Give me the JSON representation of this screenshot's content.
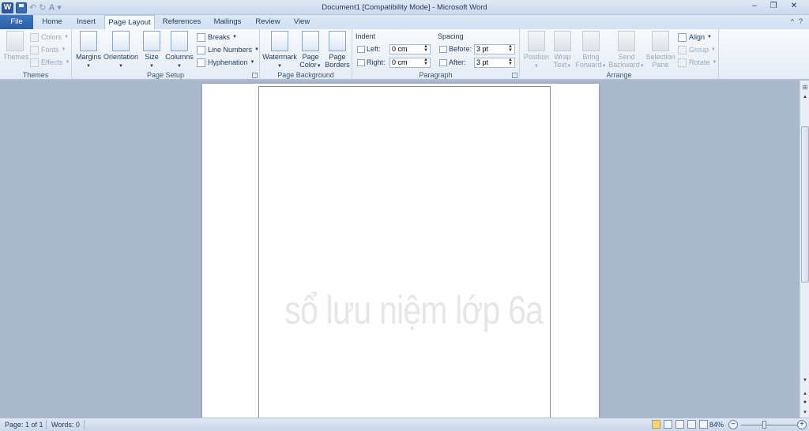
{
  "window": {
    "title": "Document1 [Compatibility Mode] - Microsoft Word",
    "app_letter": "W",
    "qat": {
      "undo": "↶",
      "redo": "↻",
      "font_color": "A",
      "customize": "▾"
    },
    "controls": {
      "minimize": "–",
      "restore": "❐",
      "close": "✕"
    }
  },
  "tabs": {
    "file": "File",
    "items": [
      "Home",
      "Insert",
      "Page Layout",
      "References",
      "Mailings",
      "Review",
      "View"
    ],
    "active": "Page Layout",
    "help_icons": {
      "minimize_ribbon": "^",
      "help": "?"
    }
  },
  "ribbon": {
    "themes": {
      "label": "Themes",
      "themes_button": "Themes",
      "colors": "Colors",
      "fonts": "Fonts",
      "effects": "Effects"
    },
    "page_setup": {
      "label": "Page Setup",
      "margins": "Margins",
      "orientation": "Orientation",
      "size": "Size",
      "columns": "Columns",
      "breaks": "Breaks",
      "line_numbers": "Line Numbers",
      "hyphenation": "Hyphenation"
    },
    "page_background": {
      "label": "Page Background",
      "watermark": "Watermark",
      "page_color_1": "Page",
      "page_color_2": "Color",
      "page_borders_1": "Page",
      "page_borders_2": "Borders"
    },
    "paragraph": {
      "label": "Paragraph",
      "indent_heading": "Indent",
      "left_label": "Left:",
      "left_value": "0 cm",
      "right_label": "Right:",
      "right_value": "0 cm",
      "spacing_heading": "Spacing",
      "before_label": "Before:",
      "before_value": "3 pt",
      "after_label": "After:",
      "after_value": "3 pt"
    },
    "arrange": {
      "label": "Arrange",
      "position": "Position",
      "wrap_1": "Wrap",
      "wrap_2": "Text",
      "bring_1": "Bring",
      "bring_2": "Forward",
      "send_1": "Send",
      "send_2": "Backward",
      "selection_1": "Selection",
      "selection_2": "Pane",
      "align": "Align",
      "group": "Group",
      "rotate": "Rotate"
    }
  },
  "document": {
    "watermark_text": "sổ lưu niệm lớp 6a"
  },
  "status": {
    "page": "Page: 1 of 1",
    "words": "Words: 0",
    "zoom": "84%",
    "zoom_percent": 84,
    "zoom_out": "−",
    "zoom_in": "+"
  }
}
